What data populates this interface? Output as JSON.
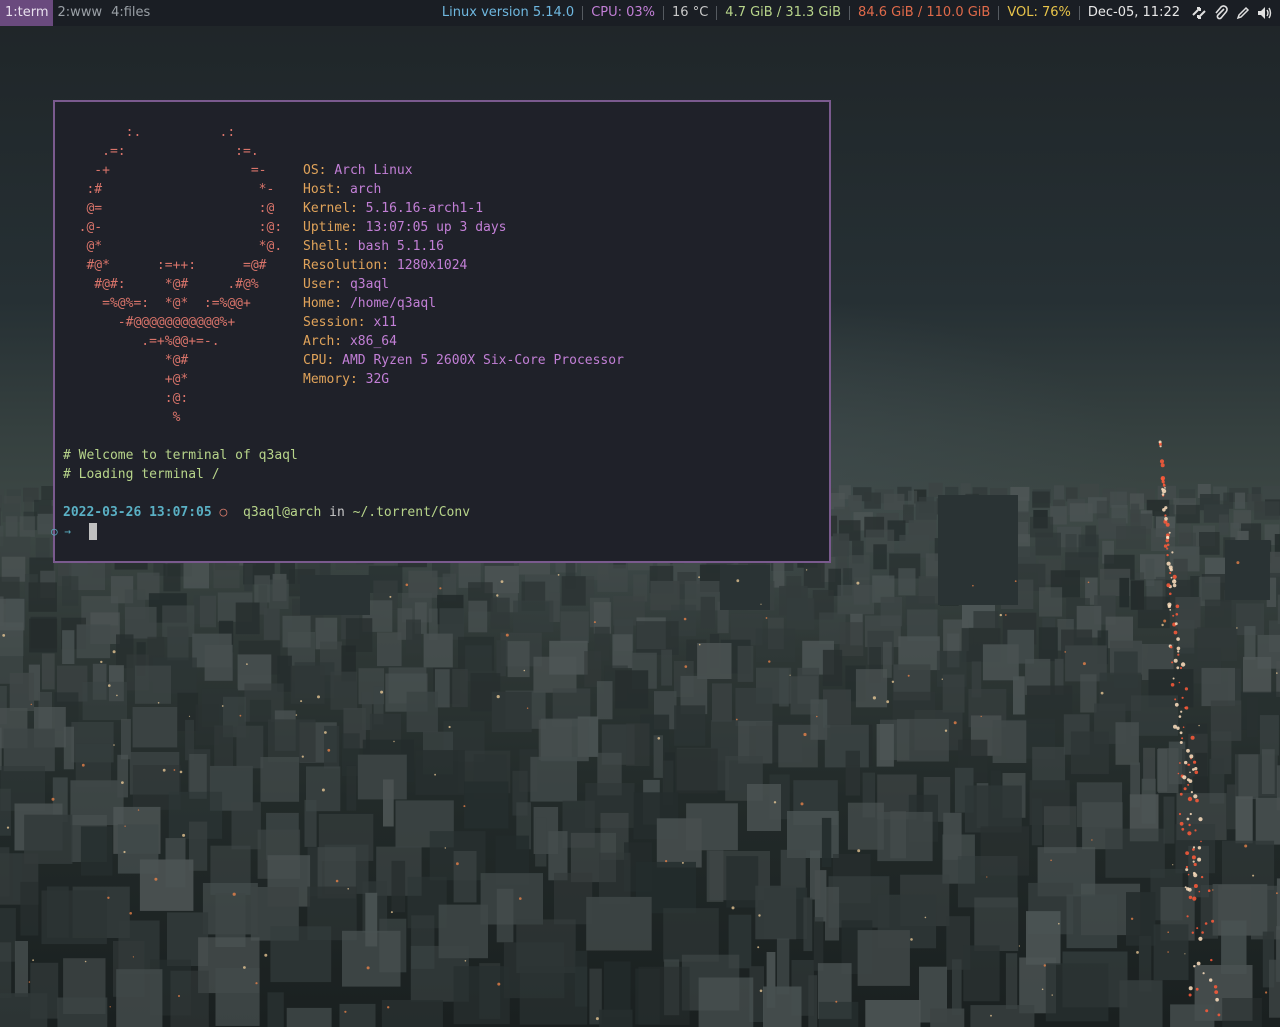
{
  "workspaces": [
    {
      "label": "1:term",
      "active": true
    },
    {
      "label": "2:www",
      "active": false
    },
    {
      "label": "4:files",
      "active": false
    }
  ],
  "status": {
    "kernel": "Linux version 5.14.0",
    "cpu": "CPU: 03%",
    "temp": "16 °C",
    "ram": "4.7 GiB / 31.3 GiB",
    "disk": "84.6 GiB / 110.0 GiB",
    "vol": "VOL: 76%",
    "datetime": "Dec-05, 11:22",
    "colors": {
      "kernel": "#6fb8e0",
      "cpu": "#c27fd6",
      "temp": "#c8c8c8",
      "ram": "#b7d48a",
      "disk": "#e06a4a",
      "vol": "#e8c44a",
      "datetime": "#e8e8e8"
    }
  },
  "tray_icons": [
    "network-arrows-icon",
    "paperclip-icon",
    "pencil-icon",
    "volume-icon"
  ],
  "terminal": {
    "art": [
      "        :.          .:",
      "     .=:              :=.",
      "    -+                  =-",
      "   :#                    *-",
      "   @=                    :@",
      "  .@-                    :@:",
      "   @*                    *@.",
      "   #@*      :=++:      =@#",
      "    #@#:     *@#     .#@%",
      "     =%@%=:  *@*  :=%@@+",
      "       -#@@@@@@@@@@@%+",
      "          .=+%@@+=-.",
      "             *@#",
      "             +@*",
      "             :@:",
      "              %"
    ],
    "info": [
      {
        "key": "OS:",
        "value": "Arch Linux"
      },
      {
        "key": "Host:",
        "value": "arch"
      },
      {
        "key": "Kernel:",
        "value": "5.16.16-arch1-1"
      },
      {
        "key": "Uptime:",
        "value": "13:07:05 up 3 days"
      },
      {
        "key": "Shell:",
        "value": "bash 5.1.16"
      },
      {
        "key": "Resolution:",
        "value": "1280x1024"
      },
      {
        "key": "User:",
        "value": "q3aql"
      },
      {
        "key": "Home:",
        "value": "/home/q3aql"
      },
      {
        "key": "Session:",
        "value": "x11"
      },
      {
        "key": "Arch:",
        "value": "x86_64"
      },
      {
        "key": "CPU:",
        "value": "AMD Ryzen 5 2600X Six-Core Processor"
      },
      {
        "key": "Memory:",
        "value": "32G"
      }
    ],
    "welcome": "# Welcome to terminal of q3aql",
    "loading": "# Loading terminal /",
    "prompt": {
      "date": "2022-03-26 13:07:05",
      "symbol": "○",
      "user_host": "q3aql@arch",
      "in": "in",
      "path": "~/.torrent/Conv",
      "arrow": "○ →"
    }
  }
}
